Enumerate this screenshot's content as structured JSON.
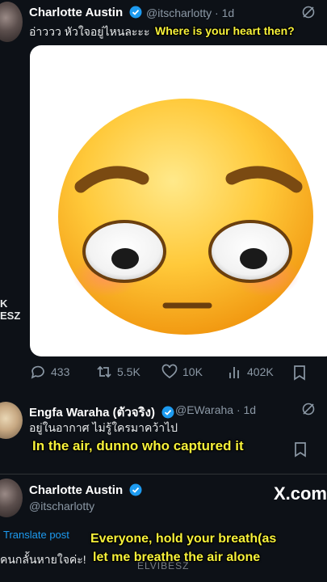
{
  "tweet1": {
    "name": "Charlotte Austin",
    "handle": "@itscharlotty",
    "time": "· 1d",
    "text": "อ่าววว หัวใจอยู่ไหนละะะ",
    "caption": "Where is your heart then?"
  },
  "actions": {
    "replies": "433",
    "retweets": "5.5K",
    "likes": "10K",
    "views": "402K"
  },
  "sidecut": {
    "line1": "K",
    "line2": "ESZ"
  },
  "tweet2": {
    "name": "Engfa Waraha (ตัวจริง)",
    "handle": "@EWaraha",
    "time": "· 1d",
    "text": "อยู่ในอากาศ  ไม่รู้ใครมาคว้าไป",
    "caption": "In the air, dunno who captured it"
  },
  "tweet3": {
    "name": "Charlotte Austin",
    "handle": "@itscharlotty",
    "site": "X.com",
    "translate": "Translate post",
    "text": "คนกลั้นหายใจค่ะ!",
    "caption_line1": "Everyone, hold your breath(as",
    "caption_line2": "let me breathe the air alone"
  },
  "watermark": "ELVIBESZ",
  "colors": {
    "background": "#0d1117",
    "verified": "#1d9bf0",
    "caption": "#f6f13a",
    "muted": "#8b98a5"
  }
}
